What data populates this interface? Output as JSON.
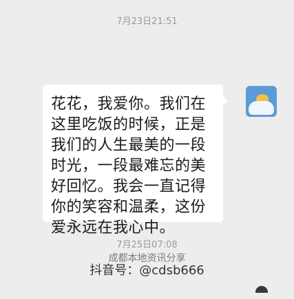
{
  "conversation": {
    "timestamp_top": "7月23日21:51",
    "message_1": "花花，我爱你。我们在这里吃饭的时候，正是我们的人生最美的一段时光，一段最难忘的美好回忆。我会一直记得你的笑容和温柔，这份爱永远在我心中。",
    "timestamp_mid": "7月25日07:08",
    "watermark_line1": "成都本地资讯分享",
    "watermark_line2": "抖音号：@cdsb666"
  },
  "colors": {
    "background": "#ededed",
    "bubble": "#ffffff",
    "avatar_bg": "#5b9bd8"
  }
}
